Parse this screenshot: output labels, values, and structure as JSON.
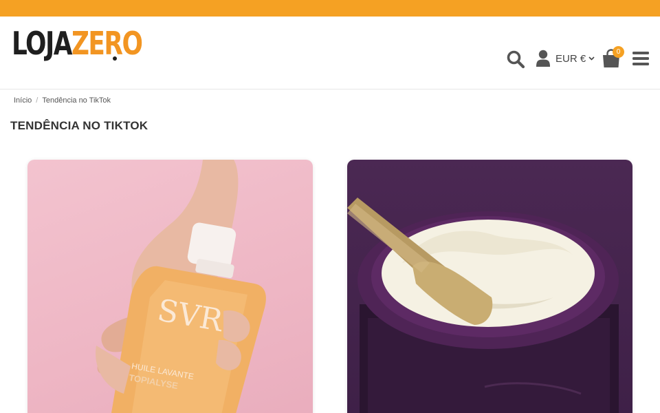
{
  "header": {
    "logo": {
      "part1": "LOJA",
      "part2": "ZERO"
    },
    "currency": "EUR €",
    "cart_count": "0",
    "icons": [
      "search-icon",
      "user-icon",
      "chevron-down-icon",
      "shopping-bag-icon",
      "menu-icon"
    ]
  },
  "breadcrumb": {
    "home": "Início",
    "separator": "/",
    "current": "Tendência no TikTok"
  },
  "page_title": "TENDÊNCIA NO TIKTOK",
  "products": [
    {
      "brand_text": "SVR",
      "line1": "HUILE LAVANTE",
      "line2": "TOPIALYSE"
    },
    {}
  ],
  "colors": {
    "accent": "#f5a123",
    "logo_dark": "#1f1f1f",
    "logo_orange": "#f29522"
  }
}
